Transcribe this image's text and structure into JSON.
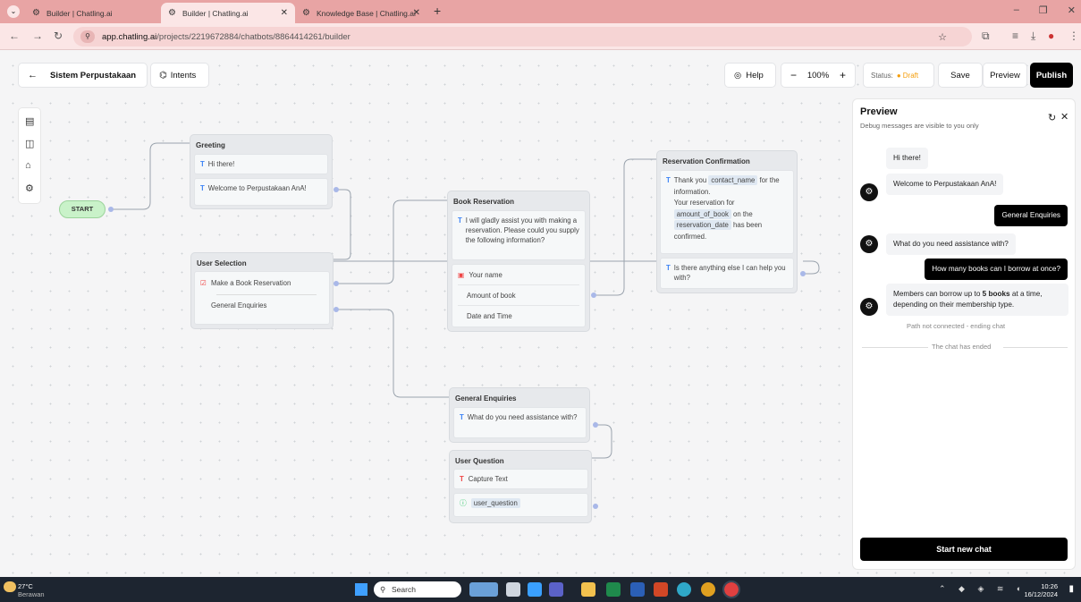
{
  "browser": {
    "tabs": [
      {
        "title": "Builder | Chatling.ai"
      },
      {
        "title": "Builder | Chatling.ai"
      },
      {
        "title": "Knowledge Base | Chatling.ai"
      }
    ],
    "url_host": "app.chatling.ai",
    "url_path": "/projects/2219672884/chatbots/8864414261/builder"
  },
  "app": {
    "back_icon": "arrow-left-icon",
    "project_name": "Sistem Perpustakaan",
    "intents_label": "Intents",
    "help_label": "Help",
    "zoom": "100%",
    "status_label": "Status:",
    "status_value": "Draft",
    "status_color": "#f59e0b",
    "save_label": "Save",
    "preview_label": "Preview",
    "publish_label": "Publish"
  },
  "flow": {
    "start_label": "START",
    "greeting": {
      "title": "Greeting",
      "items": [
        "Hi there!",
        "Welcome to Perpustakaan AnA!"
      ]
    },
    "user_selection": {
      "title": "User Selection",
      "options": [
        "Make a Book Reservation",
        "General Enquiries"
      ]
    },
    "book_reservation": {
      "title": "Book Reservation",
      "message": "I will gladly assist you with making a reservation. Please could you supply the following information?",
      "fields": [
        "Your name",
        "Amount of book",
        "Date and Time"
      ]
    },
    "reservation_confirmation": {
      "title": "Reservation Confirmation",
      "msg1_a": "Thank you",
      "msg1_var": "contact_name",
      "msg1_b": "for the information.",
      "msg1_c": "Your reservation for",
      "msg1_var2": "amount_of_book",
      "msg1_d": "on the",
      "msg1_var3": "reservation_date",
      "msg1_e": "has been confirmed.",
      "msg2": "Is there anything else I can help you with?"
    },
    "general_enquiries": {
      "title": "General Enquiries",
      "message": "What do you need assistance with?"
    },
    "user_question": {
      "title": "User Question",
      "capture": "Capture Text",
      "variable": "user_question"
    }
  },
  "preview": {
    "title": "Preview",
    "subtitle": "Debug messages are visible to you only",
    "messages": [
      {
        "from": "bot",
        "text": "Hi there!"
      },
      {
        "from": "bot",
        "text": "Welcome to Perpustakaan AnA!"
      },
      {
        "from": "user",
        "text": "General Enquiries"
      },
      {
        "from": "bot",
        "text": "What do you need assistance with?"
      },
      {
        "from": "user",
        "text": "How many books can I borrow at once?"
      }
    ],
    "answer_a": "Members can borrow up to",
    "answer_bold": "5 books",
    "answer_b": "at a time, depending on their membership type.",
    "path_note": "Path not connected - ending chat",
    "ended_note": "The chat has ended",
    "start_new_label": "Start new chat"
  },
  "taskbar": {
    "temp": "27°C",
    "weather": "Berawan",
    "search_placeholder": "Search",
    "time": "10:26",
    "date": "16/12/2024"
  }
}
